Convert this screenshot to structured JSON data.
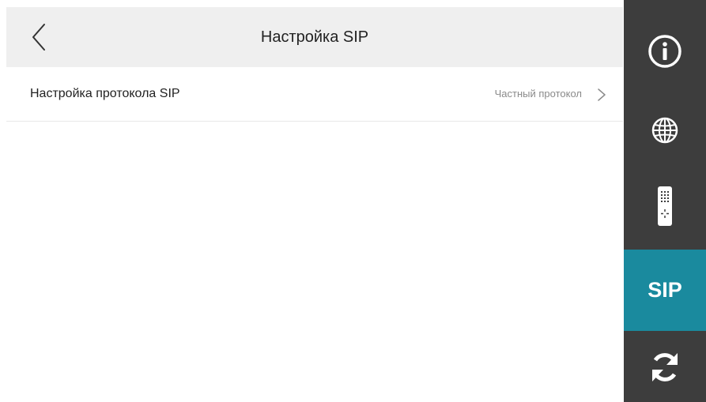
{
  "header": {
    "title": "Настройка SIP",
    "back_icon": "chevron-left-icon"
  },
  "settings": [
    {
      "label": "Настройка протокола SIP",
      "value": "Частный протокол",
      "icon": "chevron-right-icon"
    }
  ],
  "sidebar": {
    "items": [
      {
        "name": "info",
        "icon": "info-icon",
        "active": false
      },
      {
        "name": "network",
        "icon": "globe-icon",
        "active": false
      },
      {
        "name": "remote",
        "icon": "remote-control-icon",
        "active": false
      },
      {
        "name": "sip",
        "label": "SIP",
        "active": true
      },
      {
        "name": "refresh",
        "icon": "refresh-icon",
        "active": false
      }
    ]
  },
  "colors": {
    "header_bg": "#efefef",
    "sidebar_bg": "#3d3d3d",
    "active_bg": "#1a8a9e",
    "text": "#222222",
    "secondary_text": "#8a8a8a"
  }
}
